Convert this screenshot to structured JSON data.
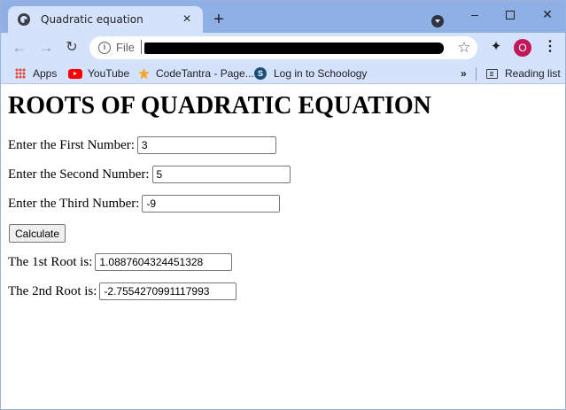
{
  "browser": {
    "tab_title": "Quadratic equation",
    "tab_close": "×",
    "new_tab": "+",
    "window_controls": {
      "minimize": "–",
      "close": "✕"
    },
    "nav": {
      "back": "←",
      "forward": "→",
      "reload": "↻"
    },
    "address": {
      "scheme": "File"
    },
    "profile_initial": "O",
    "icons": {
      "star": "☆",
      "extensions": "✦",
      "menu": "⋮"
    }
  },
  "bookmarks": {
    "apps": "Apps",
    "youtube": "YouTube",
    "codetantra": "CodeTantra - Page...",
    "schoology": "Log in to Schoology",
    "more": "»",
    "reading_list": "Reading list"
  },
  "page": {
    "heading": "ROOTS OF QUADRATIC EQUATION",
    "first_label": "Enter the First Number:",
    "first_value": "3",
    "second_label": "Enter the Second Number:",
    "second_value": "5",
    "third_label": "Enter the Third Number:",
    "third_value": "-9",
    "calculate_label": "Calculate",
    "root1_label": "The 1st Root is:",
    "root1_value": "1.0887604324451328",
    "root2_label": "The 2nd Root is:",
    "root2_value": "-2.7554270991117993"
  },
  "colors": {
    "tabstrip": "#8fb0e6",
    "toolbar": "#d5e2fb",
    "profile": "#c2185b"
  }
}
